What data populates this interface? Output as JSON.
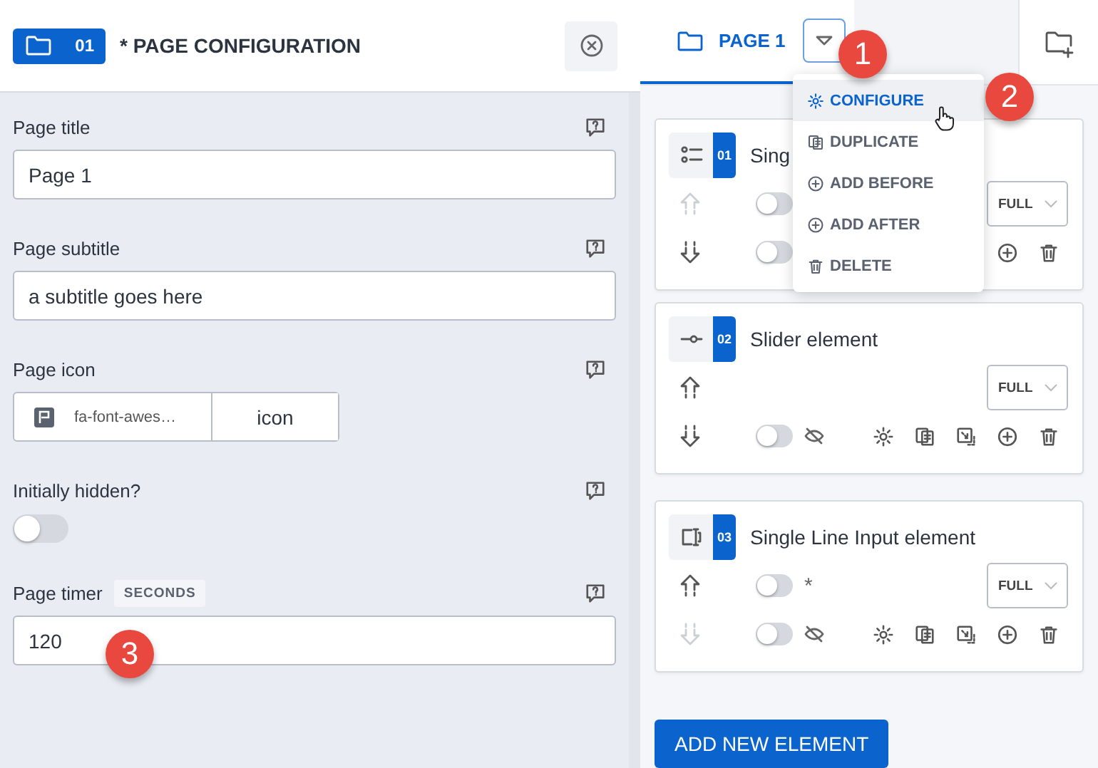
{
  "config_panel": {
    "badge_number": "01",
    "title": "* PAGE CONFIGURATION",
    "fields": [
      {
        "kind": "text",
        "label": "Page title",
        "value": "Page 1"
      },
      {
        "kind": "text",
        "label": "Page subtitle",
        "value": "a subtitle goes here"
      },
      {
        "kind": "icon",
        "label": "Page icon",
        "icon_name": "fa-font-awes…",
        "button": "icon"
      },
      {
        "kind": "toggle",
        "label": "Initially hidden?",
        "on": false
      },
      {
        "kind": "text",
        "label": "Page timer",
        "unit": "SECONDS",
        "value": "120"
      }
    ]
  },
  "page_tab": {
    "label": "PAGE 1",
    "selected": true
  },
  "page_menu": {
    "items": [
      {
        "kind": "configure",
        "label": "CONFIGURE",
        "selected": true
      },
      {
        "kind": "duplicate",
        "label": "DUPLICATE",
        "selected": false
      },
      {
        "kind": "add",
        "label": "ADD BEFORE",
        "selected": false
      },
      {
        "kind": "add",
        "label": "ADD AFTER",
        "selected": false
      },
      {
        "kind": "delete",
        "label": "DELETE",
        "selected": false
      }
    ]
  },
  "elements": [
    {
      "kind": "checklist",
      "number": "01",
      "title": "Sing",
      "up_disabled": true,
      "down_disabled": false,
      "width": "FULL",
      "top_toggle": {
        "kind": "plain",
        "on": false
      },
      "bottom_toggle": {
        "kind": "plain",
        "on": false
      },
      "actions": [
        {
          "kind": "add"
        },
        {
          "kind": "delete"
        }
      ]
    },
    {
      "kind": "slider",
      "number": "02",
      "title": "Slider element",
      "up_disabled": false,
      "down_disabled": false,
      "width": "FULL",
      "bottom_toggle": {
        "kind": "visibility",
        "on": false
      },
      "actions": [
        {
          "kind": "configure"
        },
        {
          "kind": "duplicate"
        },
        {
          "kind": "copy"
        },
        {
          "kind": "add"
        },
        {
          "kind": "delete"
        }
      ]
    },
    {
      "kind": "input",
      "number": "03",
      "title": "Single Line Input element",
      "up_disabled": false,
      "down_disabled": true,
      "width": "FULL",
      "top_toggle": {
        "kind": "required",
        "mark": "*",
        "on": false
      },
      "bottom_toggle": {
        "kind": "visibility",
        "on": false
      },
      "actions": [
        {
          "kind": "configure"
        },
        {
          "kind": "duplicate"
        },
        {
          "kind": "copy"
        },
        {
          "kind": "add"
        },
        {
          "kind": "delete"
        }
      ]
    }
  ],
  "add_button": "ADD NEW ELEMENT",
  "callouts": [
    "1",
    "2",
    "3"
  ]
}
